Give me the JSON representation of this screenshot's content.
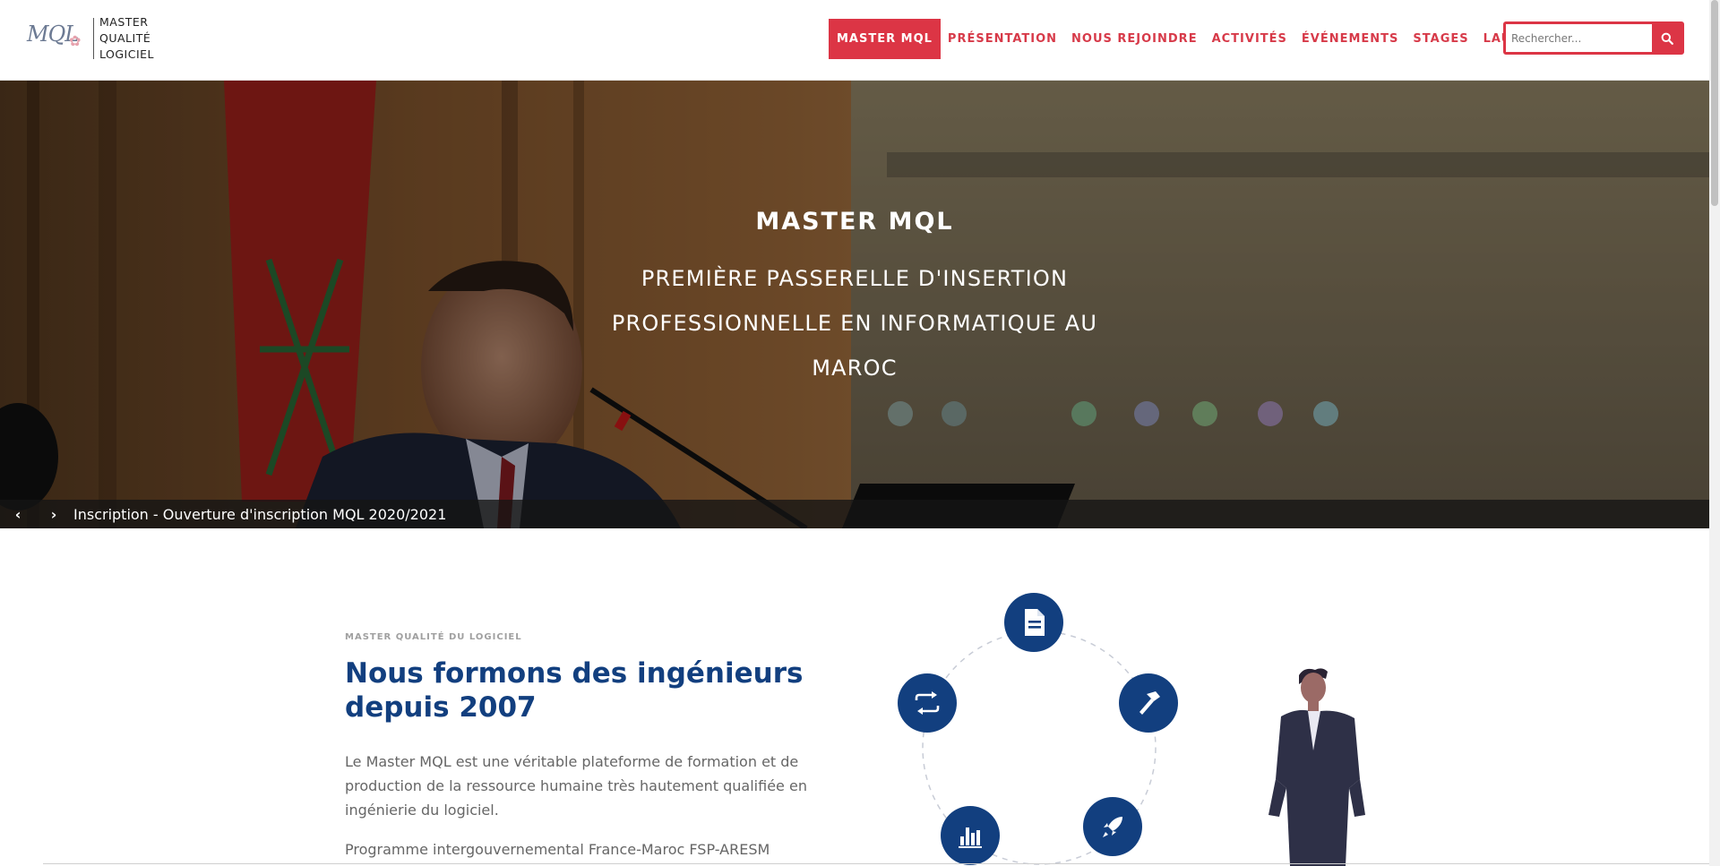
{
  "header": {
    "logo": {
      "mark_text": "MQL",
      "lines": [
        "MASTER",
        "QUALITÉ",
        "LOGICIEL"
      ]
    },
    "nav": [
      {
        "label": "MASTER MQL",
        "active": true
      },
      {
        "label": "PRÉSENTATION"
      },
      {
        "label": "NOUS REJOINDRE"
      },
      {
        "label": "ACTIVITÉS"
      },
      {
        "label": "ÉVÉNEMENTS"
      },
      {
        "label": "STAGES"
      },
      {
        "label": "LAURÉATS"
      }
    ],
    "search": {
      "placeholder": "Rechercher...",
      "icon": "search-icon"
    }
  },
  "hero": {
    "title": "MASTER MQL",
    "subtitle": "PREMIÈRE PASSERELLE D'INSERTION PROFESSIONNELLE EN INFORMATIQUE AU MAROC",
    "caption": "Inscription - Ouverture d'inscription MQL 2020/2021",
    "prev_arrow": "‹",
    "next_arrow": "›"
  },
  "intro": {
    "eyebrow": "MASTER QUALITÉ DU LOGICIEL",
    "headline": "Nous formons des ingénieurs depuis 2007",
    "paragraph1": "Le Master MQL est une véritable plateforme de formation et de production de la ressource humaine très hautement qualifiée en ingénierie du logiciel.",
    "paragraph2": "Programme intergouvernemental France-Maroc FSP-ARESM"
  },
  "diagram": {
    "icons": [
      "document-icon",
      "hammer-icon",
      "rocket-icon",
      "bar-chart-icon",
      "exchange-icon"
    ]
  },
  "colors": {
    "accent": "#dc3545",
    "primary": "#123f7f"
  }
}
